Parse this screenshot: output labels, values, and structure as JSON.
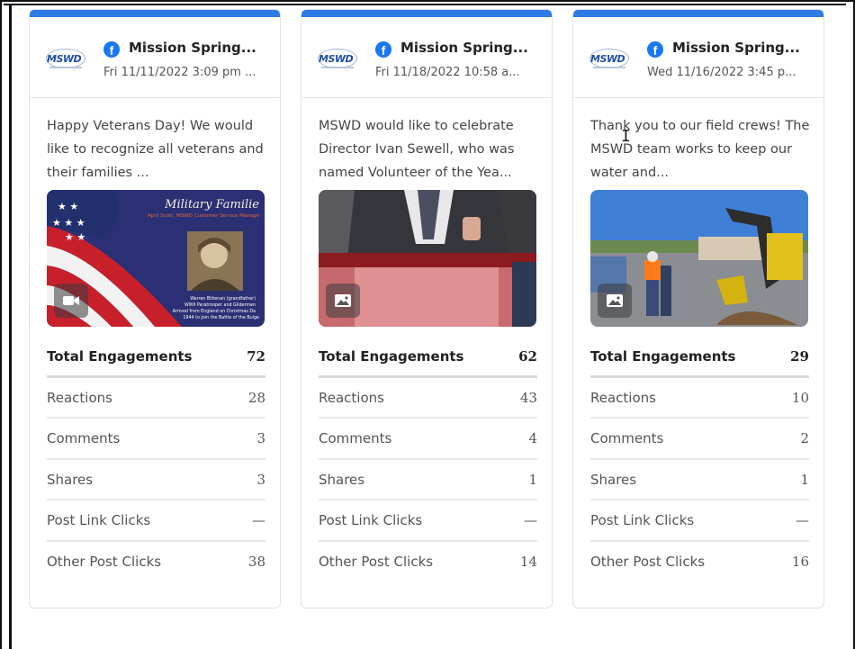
{
  "cards": [
    {
      "account": "Mission Spring...",
      "date": "Fri 11/11/2022 3:09 pm ...",
      "text": "Happy Veterans Day! We would like to recognize all veterans and their families ...",
      "media_type": "video-icon",
      "media_caption": {
        "title": "Military Familie",
        "subtitle": "April Scott, MSWD Customer Service Manage",
        "photo_caption": "Warren Bittenan (grandfather) WWII Paratrooper and Glidermen Arrived from England on Christmas Da 1944 to join the Battle of the Bulge"
      },
      "stats": [
        {
          "label": "Total Engagements",
          "value": "72"
        },
        {
          "label": "Reactions",
          "value": "28"
        },
        {
          "label": "Comments",
          "value": "3"
        },
        {
          "label": "Shares",
          "value": "3"
        },
        {
          "label": "Post Link Clicks",
          "value": "—"
        },
        {
          "label": "Other Post Clicks",
          "value": "38"
        }
      ]
    },
    {
      "account": "Mission Spring...",
      "date": "Fri 11/18/2022 10:58 a...",
      "text": "MSWD would like to celebrate Director Ivan Sewell, who was named Volunteer of the Yea...",
      "media_type": "image-icon",
      "stats": [
        {
          "label": "Total Engagements",
          "value": "62"
        },
        {
          "label": "Reactions",
          "value": "43"
        },
        {
          "label": "Comments",
          "value": "4"
        },
        {
          "label": "Shares",
          "value": "1"
        },
        {
          "label": "Post Link Clicks",
          "value": "—"
        },
        {
          "label": "Other Post Clicks",
          "value": "14"
        }
      ]
    },
    {
      "account": "Mission Spring...",
      "date": "Wed 11/16/2022 3:45 p...",
      "text": "Thank you to our field crews! The MSWD team works to keep our water and...",
      "media_type": "image-icon",
      "stats": [
        {
          "label": "Total Engagements",
          "value": "29"
        },
        {
          "label": "Reactions",
          "value": "10"
        },
        {
          "label": "Comments",
          "value": "2"
        },
        {
          "label": "Shares",
          "value": "1"
        },
        {
          "label": "Post Link Clicks",
          "value": "—"
        },
        {
          "label": "Other Post Clicks",
          "value": "16"
        }
      ]
    }
  ],
  "logo_text": "MSWD",
  "network_icon": "facebook-icon",
  "colors": {
    "accent": "#2d7be5",
    "facebook": "#1877f2"
  }
}
